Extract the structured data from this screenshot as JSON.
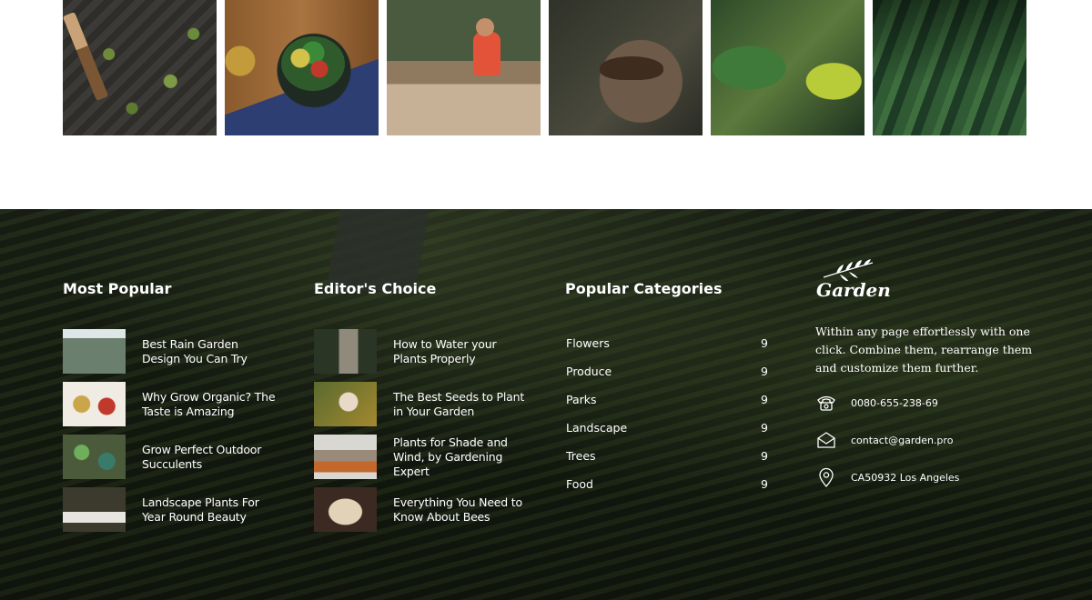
{
  "gallery": {
    "images": [
      {
        "alt": "seedlings in soil with trowel"
      },
      {
        "alt": "salad bowl on wooden table"
      },
      {
        "alt": "man working at garden table"
      },
      {
        "alt": "hands holding soil"
      },
      {
        "alt": "green ferns and leaves"
      },
      {
        "alt": "green crop rows"
      }
    ]
  },
  "footer": {
    "most_popular": {
      "title": "Most Popular",
      "posts": [
        {
          "title": "Best Rain Garden Design You Can Try"
        },
        {
          "title": "Why Grow Organic? The Taste is Amazing"
        },
        {
          "title": "Grow Perfect Outdoor Succulents"
        },
        {
          "title": "Landscape Plants For Year Round Beauty"
        }
      ]
    },
    "editors_choice": {
      "title": "Editor's Choice",
      "posts": [
        {
          "title": "How to Water your Plants Properly"
        },
        {
          "title": "The Best Seeds to Plant in Your Garden"
        },
        {
          "title": "Plants for Shade and Wind, by Gardening Expert"
        },
        {
          "title": "Everything You Need to Know About Bees"
        }
      ]
    },
    "categories": {
      "title": "Popular Categories",
      "items": [
        {
          "name": "Flowers",
          "count": "9"
        },
        {
          "name": "Produce",
          "count": "9"
        },
        {
          "name": "Parks",
          "count": "9"
        },
        {
          "name": "Landscape",
          "count": "9"
        },
        {
          "name": "Trees",
          "count": "9"
        },
        {
          "name": "Food",
          "count": "9"
        }
      ]
    },
    "about": {
      "logo_text": "Garden",
      "logo_icon": "leaf-branch-icon",
      "description": "Within any page effortlessly with one click. Combine them, rearrange them and customize them further.",
      "phone": "0080-655-238-69",
      "email": "contact@garden.pro",
      "address": "CA50932 Los Angeles"
    }
  },
  "colors": {
    "text": "#ffffff",
    "footer_bg": "#161c12"
  }
}
